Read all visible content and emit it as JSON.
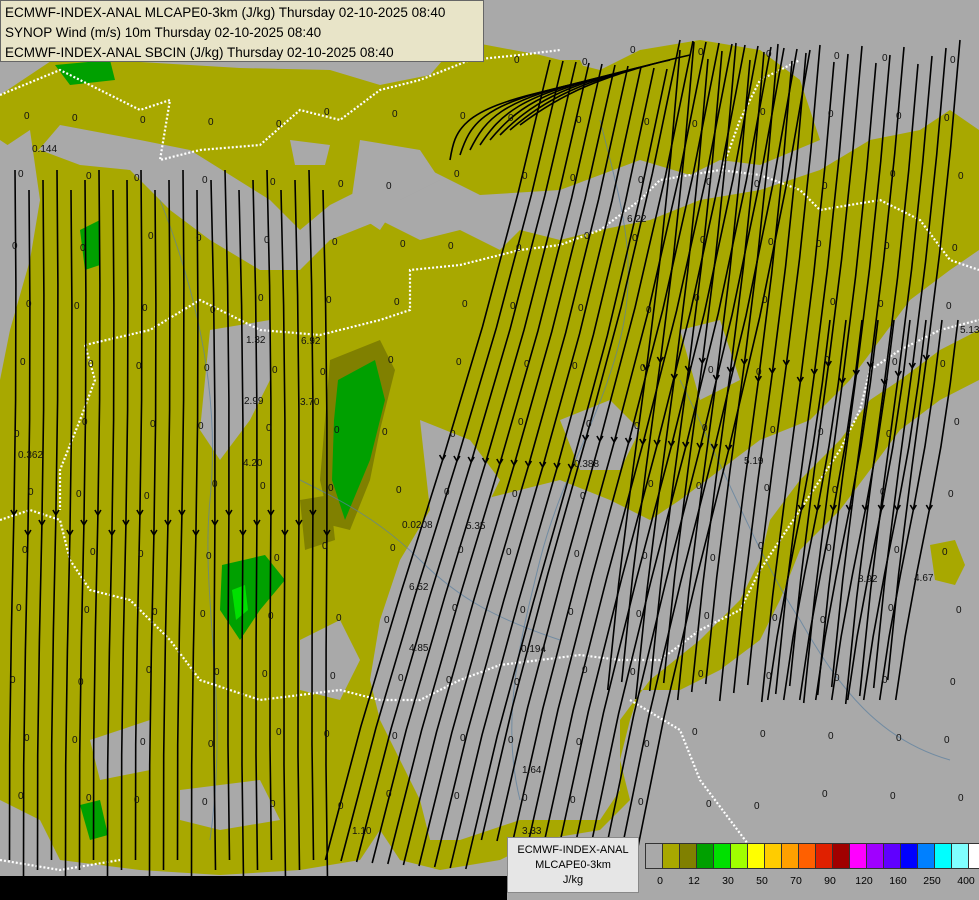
{
  "title_lines": [
    "ECMWF-INDEX-ANAL MLCAPE0-3km (J/kg) Thursday 02-10-2025 08:40",
    "SYNOP Wind (m/s) 10m Thursday 02-10-2025 08:40",
    "ECMWF-INDEX-ANAL SBCIN (J/kg) Thursday 02-10-2025 08:40"
  ],
  "legend": {
    "line1": "ECMWF-INDEX-ANAL",
    "line2": "MLCAPE0-3km",
    "line3": "J/kg",
    "ticks": [
      "0",
      "12",
      "30",
      "50",
      "70",
      "90",
      "120",
      "160",
      "250",
      "400"
    ],
    "colors": [
      "#a9a9a9",
      "#a8a800",
      "#808000",
      "#00a000",
      "#00e000",
      "#a0ff00",
      "#ffff00",
      "#ffcc00",
      "#ffa000",
      "#ff6000",
      "#e02000",
      "#a00000",
      "#ff00ff",
      "#a000ff",
      "#6000ff",
      "#0000ff",
      "#0080ff",
      "#00ffff",
      "#80ffff",
      "#ffffff"
    ]
  },
  "station_values": [
    {
      "t": "0.144"
    },
    {
      "t": "0.362"
    },
    {
      "t": "1.32"
    },
    {
      "t": "6.92"
    },
    {
      "t": "2.99"
    },
    {
      "t": "3.70"
    },
    {
      "t": "4.20"
    },
    {
      "t": "0.0208"
    },
    {
      "t": "5.35"
    },
    {
      "t": "0.388"
    },
    {
      "t": "5.19"
    },
    {
      "t": "6.52"
    },
    {
      "t": "4.85"
    },
    {
      "t": "0.194"
    },
    {
      "t": "1.64"
    },
    {
      "t": "3.33"
    },
    {
      "t": "1.10"
    },
    {
      "t": "8.92"
    },
    {
      "t": "4.67"
    },
    {
      "t": "5.13"
    },
    {
      "t": "6.22"
    }
  ],
  "zero_label": "0",
  "colors": {
    "cape_low": "#a8a800",
    "background": "#a9a9a9",
    "border": "#ffffff",
    "stream": "#000000"
  }
}
